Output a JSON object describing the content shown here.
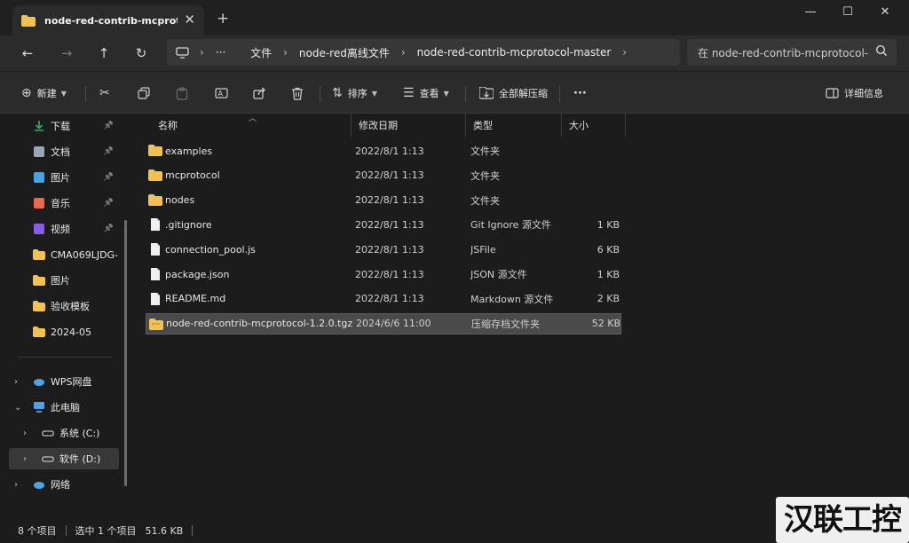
{
  "window": {
    "tab_title": "node-red-contrib-mcprotocol-",
    "tab_close": "✕",
    "new_tab": "+",
    "minimize": "—",
    "maximize": "☐",
    "close": "✕"
  },
  "address_bar": {
    "overflow": "···",
    "breadcrumbs": [
      "文件",
      "node-red离线文件",
      "node-red-contrib-mcprotocol-master"
    ],
    "search_placeholder": "在 node-red-contrib-mcprotocol-"
  },
  "toolbar": {
    "new_label": "新建",
    "sort_label": "排序",
    "view_label": "查看",
    "extract_label": "全部解压缩",
    "more_label": "···",
    "details_label": "详细信息"
  },
  "sidebar": {
    "quick": [
      {
        "label": "下载",
        "pinned": true,
        "color": "#3ea86a"
      },
      {
        "label": "文档",
        "pinned": true,
        "color": "#9aa7b8"
      },
      {
        "label": "图片",
        "pinned": true,
        "color": "#4aa3e8"
      },
      {
        "label": "音乐",
        "pinned": true,
        "color": "#e86a4a"
      },
      {
        "label": "视频",
        "pinned": true,
        "color": "#8a5ae8"
      },
      {
        "label": "CMA069LJDG-",
        "pinned": false,
        "color": "#f2c14e"
      },
      {
        "label": "图片",
        "pinned": false,
        "color": "#f2c14e"
      },
      {
        "label": "验收模板",
        "pinned": false,
        "color": "#f2c14e"
      },
      {
        "label": "2024-05",
        "pinned": false,
        "color": "#f2c14e"
      }
    ],
    "tree": [
      {
        "label": "WPS网盘",
        "expanded": false
      },
      {
        "label": "此电脑",
        "expanded": true
      },
      {
        "label": "系统 (C:)",
        "expanded": false
      },
      {
        "label": "软件 (D:)",
        "expanded": false
      },
      {
        "label": "网络",
        "expanded": false
      }
    ]
  },
  "columns": {
    "name": "名称",
    "date": "修改日期",
    "type": "类型",
    "size": "大小"
  },
  "files": [
    {
      "name": "examples",
      "date": "2022/8/1 1:13",
      "type": "文件夹",
      "size": "",
      "kind": "folder"
    },
    {
      "name": "mcprotocol",
      "date": "2022/8/1 1:13",
      "type": "文件夹",
      "size": "",
      "kind": "folder"
    },
    {
      "name": "nodes",
      "date": "2022/8/1 1:13",
      "type": "文件夹",
      "size": "",
      "kind": "folder"
    },
    {
      "name": ".gitignore",
      "date": "2022/8/1 1:13",
      "type": "Git Ignore 源文件",
      "size": "1 KB",
      "kind": "file"
    },
    {
      "name": "connection_pool.js",
      "date": "2022/8/1 1:13",
      "type": "JSFile",
      "size": "6 KB",
      "kind": "file"
    },
    {
      "name": "package.json",
      "date": "2022/8/1 1:13",
      "type": "JSON 源文件",
      "size": "1 KB",
      "kind": "file"
    },
    {
      "name": "README.md",
      "date": "2022/8/1 1:13",
      "type": "Markdown 源文件",
      "size": "2 KB",
      "kind": "file"
    },
    {
      "name": "node-red-contrib-mcprotocol-1.2.0.tgz",
      "date": "2024/6/6 11:00",
      "type": "压缩存档文件夹",
      "size": "52 KB",
      "kind": "archive",
      "selected": true
    }
  ],
  "status": {
    "count": "8 个项目",
    "selected": "选中 1 个项目",
    "size": "51.6 KB"
  },
  "watermark": "汉联工控吧",
  "colors": {
    "folder": "#f2c14e",
    "accent": "#4aa3e8",
    "selected_row": "#4a4a4a"
  }
}
